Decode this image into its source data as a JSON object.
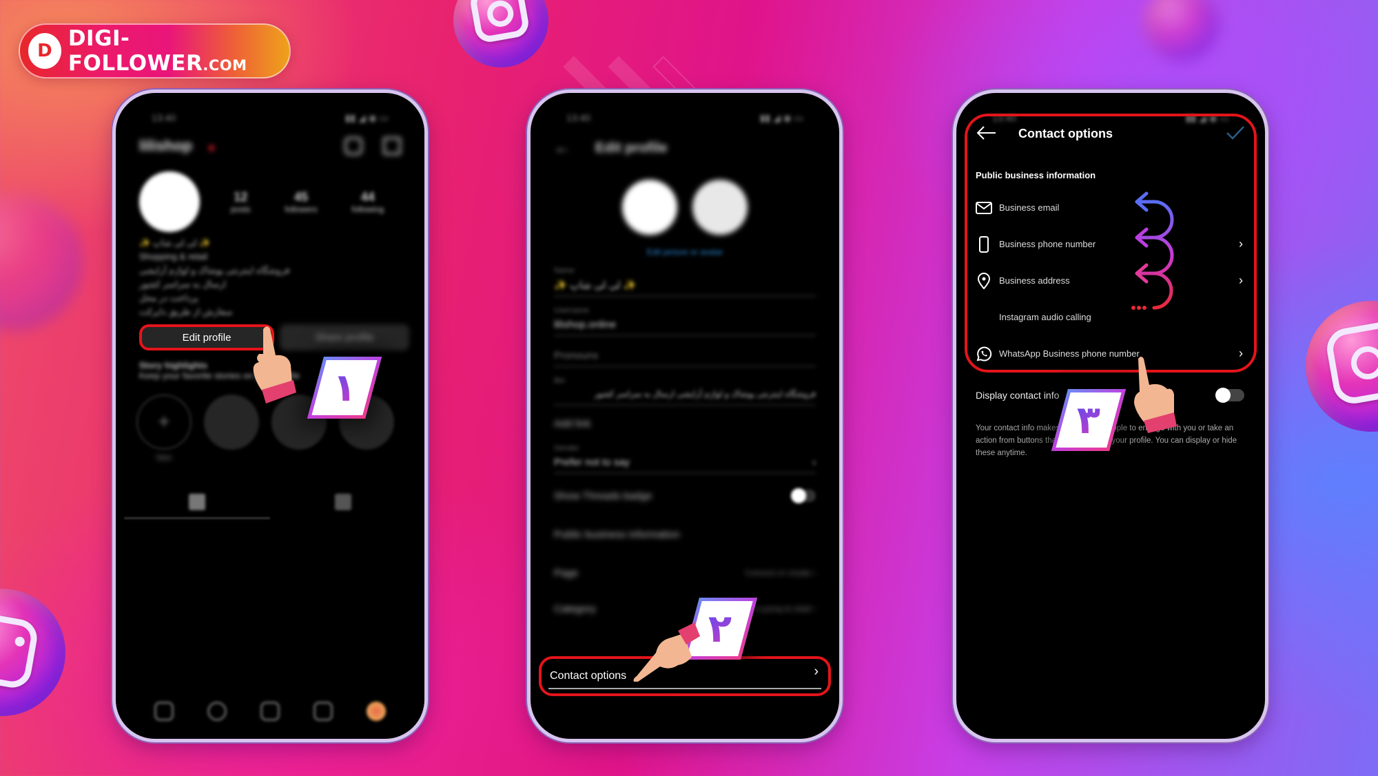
{
  "brand": {
    "logo_text": "DIGI-FOLLOWER",
    "logo_suffix": ".COM",
    "logo_mark": "D"
  },
  "colors": {
    "highlight_red": "#e4141b",
    "link_blue": "#2a88d8",
    "badge_gradient": [
      "#6a8cf6",
      "#c040e0",
      "#ee3a8a"
    ]
  },
  "steps": [
    {
      "number_label": "١",
      "target": "Edit profile"
    },
    {
      "number_label": "٢",
      "target": "Contact options"
    },
    {
      "number_label": "٣",
      "target": "Display contact info"
    }
  ],
  "phone1": {
    "screen": "profile",
    "status_time": "13:40",
    "username": "lilishop",
    "stats": [
      {
        "value": "12",
        "label": "posts"
      },
      {
        "value": "45",
        "label": "followers"
      },
      {
        "value": "44",
        "label": "following"
      }
    ],
    "bio_lines": [
      "✨ لی لی شاپ ✨",
      "Shopping & retail",
      "فروشگاه اینترنتی پوشاک و لوازم آرایشی",
      "ارسال به سراسر کشور",
      "پرداخت در محل",
      "سفارش از طریق دایرکت"
    ],
    "edit_profile_label": "Edit profile",
    "share_profile_label": "Share profile",
    "highlights_title": "Story highlights",
    "highlights_subtitle": "Keep your favorite stories on your profile",
    "new_highlight_label": "New",
    "bottom_nav": [
      "home-icon",
      "search-icon",
      "create-icon",
      "reels-icon",
      "profile-avatar"
    ]
  },
  "phone2": {
    "screen": "edit-profile",
    "status_time": "13:40",
    "title": "Edit profile",
    "edit_picture_link": "Edit picture or avatar",
    "fields": [
      {
        "label": "Name",
        "value": "✨ لی لی شاپ ✨"
      },
      {
        "label": "Username",
        "value": "lilishop.online"
      },
      {
        "label": "",
        "value": "Pronouns"
      },
      {
        "label": "Bio",
        "value": "فروشگاه اینترنتی پوشاک و لوازم آرایشی ارسال به سراسر کشور"
      }
    ],
    "add_link_label": "Add link",
    "gender_label": "Gender",
    "gender_value": "Prefer not to say",
    "threads_badge_label": "Show Threads badge",
    "public_business_info_label": "Public business information",
    "page_label": "Page",
    "page_value": "Connect or create",
    "category_label": "Category",
    "category_value": "Shopping & retail",
    "contact_options_label": "Contact options"
  },
  "phone3": {
    "screen": "contact-options",
    "status_time": "13:40",
    "title": "Contact options",
    "section_title": "Public business information",
    "items": [
      {
        "icon": "mail-icon",
        "label": "Business email",
        "chevron": false
      },
      {
        "icon": "phone-icon",
        "label": "Business phone number",
        "chevron": true
      },
      {
        "icon": "location-pin-icon",
        "label": "Business address",
        "chevron": true
      },
      {
        "icon": "",
        "label": "Instagram audio calling",
        "chevron": false
      },
      {
        "icon": "whatsapp-icon",
        "label": "WhatsApp Business phone number",
        "chevron": true
      }
    ],
    "display_contact_label": "Display contact info",
    "display_contact_enabled": false,
    "description": "Your contact info makes it easier for people to engage with you or take an action from buttons that will appear on your profile. You can display or hide these anytime."
  }
}
